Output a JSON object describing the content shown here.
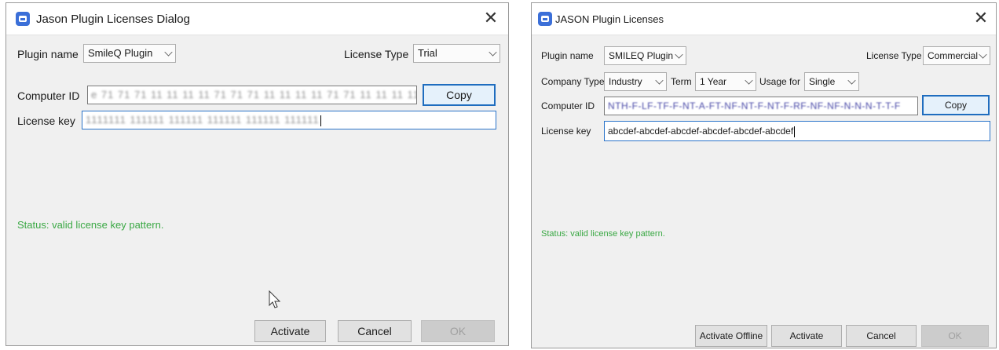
{
  "left_dialog": {
    "title": "Jason Plugin Licenses Dialog",
    "plugin_name_label": "Plugin name",
    "plugin_name_value": "SmileQ Plugin",
    "license_type_label": "License Type",
    "license_type_value": "Trial",
    "computer_id_label": "Computer ID",
    "computer_id_value": "e 71 71 71 11 11 11 11 71 71 71 11 11 11 11 71 71 11 11 11 11 1",
    "copy_label": "Copy",
    "license_key_label": "License key",
    "license_key_value": "1111111 111111 111111 111111 111111 111111",
    "status": "Status: valid license key pattern.",
    "activate_label": "Activate",
    "cancel_label": "Cancel",
    "ok_label": "OK"
  },
  "right_dialog": {
    "title": "JASON Plugin Licenses",
    "plugin_name_label": "Plugin name",
    "plugin_name_value": "SMILEQ Plugin",
    "license_type_label": "License Type",
    "license_type_value": "Commercial",
    "company_type_label": "Company Type",
    "company_type_value": "Industry",
    "term_label": "Term",
    "term_value": "1 Year",
    "usage_label": "Usage for",
    "usage_value": "Single",
    "computer_id_label": "Computer ID",
    "computer_id_value": "NTH-F-LF-TF-F-NT-A-FT-NF-NT-F-NT-F-RF-NF-NF-N-N-N-T-T-F",
    "copy_label": "Copy",
    "license_key_label": "License key",
    "license_key_value": "abcdef-abcdef-abcdef-abcdef-abcdef-abcdef",
    "status": "Status: valid license key pattern.",
    "activate_offline_label": "Activate Offline",
    "activate_label": "Activate",
    "cancel_label": "Cancel",
    "ok_label": "OK"
  },
  "icons": {
    "app": "app-logo-icon",
    "close": "close-icon",
    "dropdown": "chevron-down-icon",
    "pointer": "mouse-pointer-icon"
  },
  "colors": {
    "status_text": "#3aa844",
    "focus_border": "#1f6dbf",
    "app_icon": "#3b6fd8",
    "dialog_bg": "#f0f0f0"
  }
}
